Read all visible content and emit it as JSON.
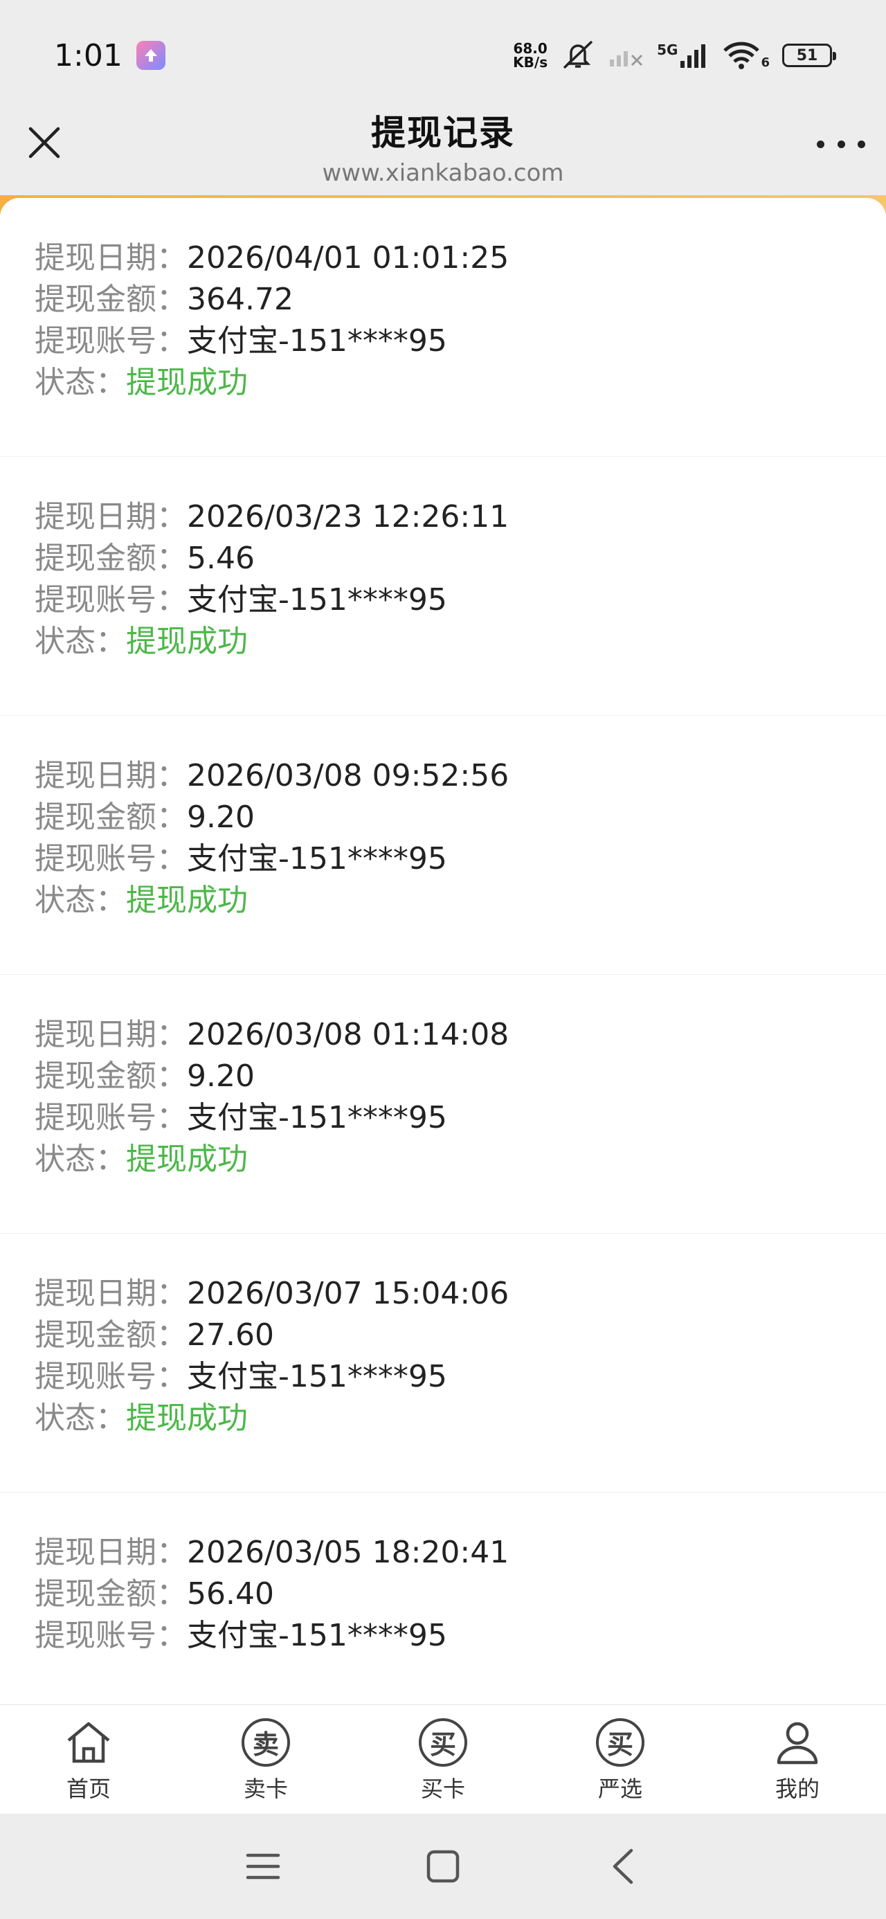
{
  "status_bar": {
    "time": "1:01",
    "net_speed_value": "68.0",
    "net_speed_unit": "KB/s",
    "signal_label": "5G",
    "wifi_level": "6",
    "battery": "51"
  },
  "header": {
    "title": "提现记录",
    "url": "www.xiankabao.com"
  },
  "labels": {
    "date": "提现日期：",
    "amount": "提现金额：",
    "account": "提现账号：",
    "status": "状态："
  },
  "records": [
    {
      "date": "2026/04/01 01:01:25",
      "amount": "364.72",
      "account": "支付宝-151****95",
      "status": "提现成功"
    },
    {
      "date": "2026/03/23 12:26:11",
      "amount": "5.46",
      "account": "支付宝-151****95",
      "status": "提现成功"
    },
    {
      "date": "2026/03/08 09:52:56",
      "amount": "9.20",
      "account": "支付宝-151****95",
      "status": "提现成功"
    },
    {
      "date": "2026/03/08 01:14:08",
      "amount": "9.20",
      "account": "支付宝-151****95",
      "status": "提现成功"
    },
    {
      "date": "2026/03/07 15:04:06",
      "amount": "27.60",
      "account": "支付宝-151****95",
      "status": "提现成功"
    },
    {
      "date": "2026/03/05 18:20:41",
      "amount": "56.40",
      "account": "支付宝-151****95",
      "status": ""
    }
  ],
  "bottom_nav": [
    {
      "label": "首页",
      "icon": "home-icon"
    },
    {
      "label": "卖卡",
      "icon": "sell-card-icon",
      "glyph": "卖"
    },
    {
      "label": "买卡",
      "icon": "buy-card-icon",
      "glyph": "买"
    },
    {
      "label": "严选",
      "icon": "selected-icon",
      "glyph": "买"
    },
    {
      "label": "我的",
      "icon": "profile-icon"
    }
  ],
  "colors": {
    "status_success": "#4cb848",
    "accent_strip": "#f5b041"
  }
}
